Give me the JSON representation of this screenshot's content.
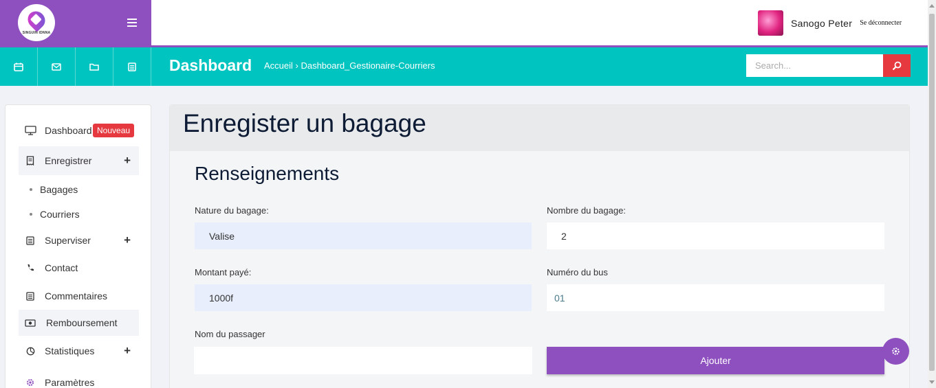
{
  "header": {
    "logo_text": "SINGUIN IDNNA",
    "user_name": "Sanogo Peter",
    "logout_label": "Se déconnecter"
  },
  "toolbar": {
    "icons": [
      "calendar-icon",
      "mail-icon",
      "folder-icon",
      "document-icon"
    ],
    "title": "Dashboard",
    "breadcrumb": "Accueil › Dashboard_Gestionaire-Courriers",
    "search_placeholder": "Search..."
  },
  "sidebar": {
    "items": [
      {
        "label": "Dashboard",
        "icon": "monitor-icon",
        "badge": "Nouveau"
      },
      {
        "label": "Enregistrer",
        "icon": "receipt-icon",
        "expand": "+"
      },
      {
        "label": "Bagages",
        "sub": true
      },
      {
        "label": "Courriers",
        "sub": true
      },
      {
        "label": "Superviser",
        "icon": "document-icon",
        "expand": "+"
      },
      {
        "label": "Contact",
        "icon": "phone-icon"
      },
      {
        "label": "Commentaires",
        "icon": "document-icon"
      },
      {
        "label": "Remboursement",
        "icon": "money-icon"
      },
      {
        "label": "Statistiques",
        "icon": "pie-chart-icon",
        "expand": "+"
      },
      {
        "label": "Paramètres",
        "icon": "gear-icon"
      }
    ]
  },
  "main": {
    "title": "Enregister un bagage",
    "section": "Renseignements",
    "fields": {
      "nature": {
        "label": "Nature du bagage:",
        "value": "Valise"
      },
      "nombre": {
        "label": "Nombre du bagage:",
        "value": "2"
      },
      "montant": {
        "label": "Montant payé:",
        "value": "1000f"
      },
      "bus": {
        "label": "Numéro du bus",
        "value": "01"
      },
      "passager": {
        "label": "Nom du passager",
        "value": ""
      }
    },
    "submit_label": "Ajouter"
  },
  "colors": {
    "purple": "#8e4fbf",
    "teal": "#00c4c0",
    "red": "#e5393f",
    "input_fill": "#e8eefb"
  }
}
